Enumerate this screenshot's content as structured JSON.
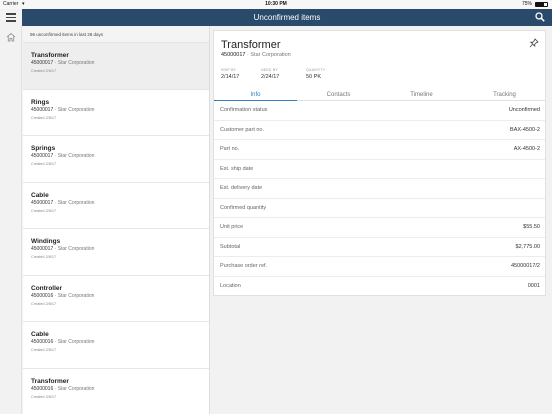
{
  "status_bar": {
    "carrier": "Carrier",
    "time": "10:30 PM",
    "battery": "75%"
  },
  "navbar": {
    "title": "Unconfirmed items"
  },
  "list": {
    "header": "96 unconfirmed items in last 28 days",
    "items": [
      {
        "title": "Transformer",
        "number": "45000017",
        "org": "Star Corporation",
        "created": "Created 2/8/17"
      },
      {
        "title": "Rings",
        "number": "45000017",
        "org": "Star Corporation",
        "created": "Created 2/8/17"
      },
      {
        "title": "Springs",
        "number": "45000017",
        "org": "Star Corporation",
        "created": "Created 2/8/17"
      },
      {
        "title": "Cable",
        "number": "45000017",
        "org": "Star Corporation",
        "created": "Created 2/8/17"
      },
      {
        "title": "Windings",
        "number": "45000017",
        "org": "Star Corporation",
        "created": "Created 2/8/17"
      },
      {
        "title": "Controller",
        "number": "45000016",
        "org": "Star Corporation",
        "created": "Created 2/8/17"
      },
      {
        "title": "Cable",
        "number": "45000016",
        "org": "Star Corporation",
        "created": "Created 2/8/17"
      },
      {
        "title": "Transformer",
        "number": "45000016",
        "org": "Star Corporation",
        "created": "Created 2/8/17"
      }
    ]
  },
  "detail": {
    "title": "Transformer",
    "number": "45000017",
    "org": "Star Corporation",
    "meta": [
      {
        "label": "SHIP BY",
        "value": "2/14/17"
      },
      {
        "label": "NEED BY",
        "value": "2/24/17"
      },
      {
        "label": "QUANTITY",
        "value": "50 PK"
      }
    ],
    "tabs": [
      "Info",
      "Contacts",
      "Timeline",
      "Tracking"
    ],
    "rows": [
      {
        "label": "Confirmation status",
        "value": "Unconfirmed"
      },
      {
        "label": "Customer part no.",
        "value": "BAX-4500-2"
      },
      {
        "label": "Part no.",
        "value": "AX-4500-2"
      },
      {
        "label": "Est. ship date",
        "value": ""
      },
      {
        "label": "Est. delivery date",
        "value": ""
      },
      {
        "label": "Confirmed quantity",
        "value": ""
      },
      {
        "label": "Unit price",
        "value": "$55.50"
      },
      {
        "label": "Subtotal",
        "value": "$2,775.00"
      },
      {
        "label": "Purchase order ref.",
        "value": "45000017/2"
      },
      {
        "label": "Location",
        "value": "0001"
      }
    ]
  },
  "colors": {
    "navbar": "#2a4a6b",
    "accent": "#2f7fc1"
  }
}
